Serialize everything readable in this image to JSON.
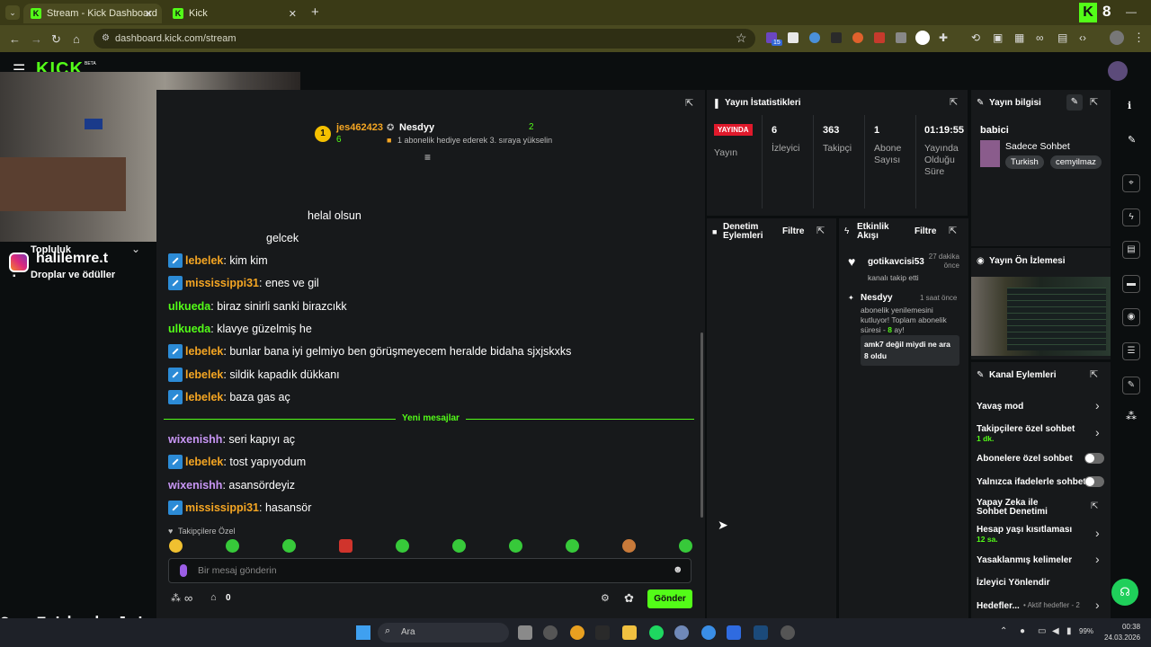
{
  "browser": {
    "tabs": [
      {
        "label": "Stream - Kick Dashboard"
      },
      {
        "label": "Kick"
      }
    ],
    "url": "dashboard.kick.com/stream",
    "profile_badge": "8",
    "ext_count": "15"
  },
  "kick": {
    "logo": "KICK",
    "beta": "BETA"
  },
  "overlay": {
    "instagram": "halilemre.t",
    "menu_partial": "Topluluk",
    "drops": "Droplar ve ödüller",
    "last_follower_label": "Son Takipçi:",
    "last_follower_name": "lvbyuu"
  },
  "chat_header": {
    "rank": "1",
    "top_user": "jes462423",
    "top_user_count": "6",
    "gifter": "Nesdyy",
    "gifter_count": "2",
    "gift_text": "1 abonelik hediye ederek 3. sıraya yükselin"
  },
  "chat": {
    "messages": [
      {
        "user": "",
        "text": "helal olsun"
      },
      {
        "user": "",
        "text": "gelcek"
      },
      {
        "user": "lebelek",
        "text": "kim kim"
      },
      {
        "user": "mississippi31",
        "text": "enes ve gil"
      },
      {
        "user": "ulkueda",
        "text": "biraz sinirli sanki birazcıkk"
      },
      {
        "user": "ulkueda",
        "text": "klavye güzelmiş he"
      },
      {
        "user": "lebelek",
        "text": "bunlar bana iyi gelmiyo ben görüşmeyecem heralde bidaha sjxjskxks"
      },
      {
        "user": "lebelek",
        "text": "sildik kapadık dükkanı"
      },
      {
        "user": "lebelek",
        "text": "baza gas aç"
      },
      {
        "user": "wixenishh",
        "text": "seri kapıyı aç"
      },
      {
        "user": "lebelek",
        "text": "tost yapıyodum"
      },
      {
        "user": "wixenishh",
        "text": "asansördeyiz"
      },
      {
        "user": "mississippi31",
        "text": "hasansör"
      }
    ],
    "new_messages": "Yeni mesajlar",
    "followers_only": "Takipçilere Özel",
    "placeholder": "Bir mesaj gönderin",
    "points": "∞",
    "gift_count": "0",
    "send": "Gönder"
  },
  "stats": {
    "title": "Yayın İstatistikleri",
    "live": "YAYINDA",
    "live_label": "Yayın",
    "viewers": "6",
    "viewers_label": "İzleyici",
    "followers": "363",
    "followers_label": "Takipçi",
    "subs": "1",
    "subs_label": "Abone Sayısı",
    "duration": "01:19:55",
    "duration_label": "Yayında Olduğu Süre"
  },
  "info": {
    "title": "Yayın bilgisi",
    "stream_title": "babici",
    "category": "Sadece Sohbet",
    "tags": [
      "Turkish",
      "cemyilmaz"
    ]
  },
  "preview": {
    "title": "Yayın Ön İzlemesi"
  },
  "mod": {
    "title": "Denetim Eylemleri",
    "filter": "Filtre"
  },
  "activity": {
    "title": "Etkinlik Akışı",
    "filter": "Filtre",
    "items": [
      {
        "user": "gotikavcisi53",
        "time": "27 dakika önce",
        "text": "kanalı takip etti"
      },
      {
        "user": "Nesdyy",
        "time": "1 saat önce",
        "text": "abonelik yenilemesini kutluyor! Toplam abonelik süresi -",
        "months": "8",
        "months_suffix": "ay!",
        "msg": "amk7 değil miydi ne ara 8 oldu"
      }
    ]
  },
  "channel_actions": {
    "title": "Kanal Eylemleri",
    "slow": "Yavaş mod",
    "followers_chat": "Takipçilere özel sohbet",
    "followers_chat_val": "1 dk.",
    "subs_chat": "Abonelere özel sohbet",
    "emote_only": "Yalnızca ifadelerle sohbet",
    "ai_mod": "Yapay Zeka ile Sohbet Denetimi",
    "age": "Hesap yaşı kısıtlaması",
    "age_val": "12 sa.",
    "banned_words": "Yasaklanmış kelimeler",
    "redirect": "İzleyici Yönlendir",
    "goals": "Hedefler...",
    "goals_val": "Aktif hedefler - 2"
  },
  "taskbar": {
    "search": "Ara",
    "battery": "99%",
    "time": "00:38",
    "date": "24.03.2026"
  }
}
